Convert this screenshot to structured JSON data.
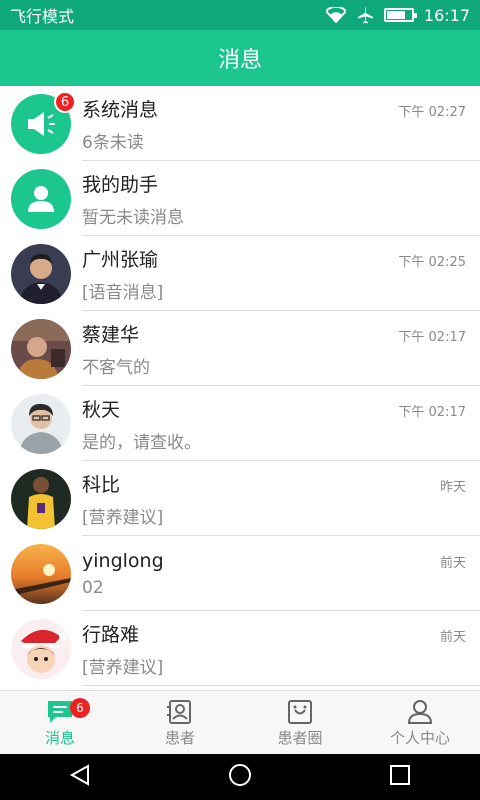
{
  "status_bar": {
    "mode": "飞行模式",
    "time": "16:17",
    "battery_level": 0.75
  },
  "header": {
    "title": "消息"
  },
  "conversations": [
    {
      "name": "系统消息",
      "time": "下午 02:27",
      "message": "6条未读",
      "badge": "6",
      "avatar": "megaphone-icon"
    },
    {
      "name": "我的助手",
      "time": "",
      "message": "暂无未读消息",
      "badge": "",
      "avatar": "person-icon"
    },
    {
      "name": "广州张瑜",
      "time": "下午 02:25",
      "message": "[语音消息]",
      "badge": "",
      "avatar": "photo"
    },
    {
      "name": " 蔡建华",
      "time": "下午 02:17",
      "message": "不客气的",
      "badge": "",
      "avatar": "photo"
    },
    {
      "name": "秋天",
      "time": "下午 02:17",
      "message": "是的，请查收。",
      "badge": "",
      "avatar": "photo"
    },
    {
      "name": "科比",
      "time": "昨天",
      "message": "[营养建议]",
      "badge": "",
      "avatar": "photo"
    },
    {
      "name": "yinglong",
      "time": "前天",
      "message": "02",
      "badge": "",
      "avatar": "photo"
    },
    {
      "name": "行路难",
      "time": "前天",
      "message": "[营养建议]",
      "badge": "",
      "avatar": "photo"
    }
  ],
  "tabs": [
    {
      "label": "消息",
      "icon": "chat-icon",
      "badge": "6",
      "active": true
    },
    {
      "label": "患者",
      "icon": "patient-card-icon",
      "badge": "",
      "active": false
    },
    {
      "label": "患者圈",
      "icon": "smile-box-icon",
      "badge": "",
      "active": false
    },
    {
      "label": "个人中心",
      "icon": "user-icon",
      "badge": "",
      "active": false
    }
  ],
  "colors": {
    "primary": "#1cc68f",
    "status_bar": "#0fa87a",
    "badge": "#ee2222"
  }
}
